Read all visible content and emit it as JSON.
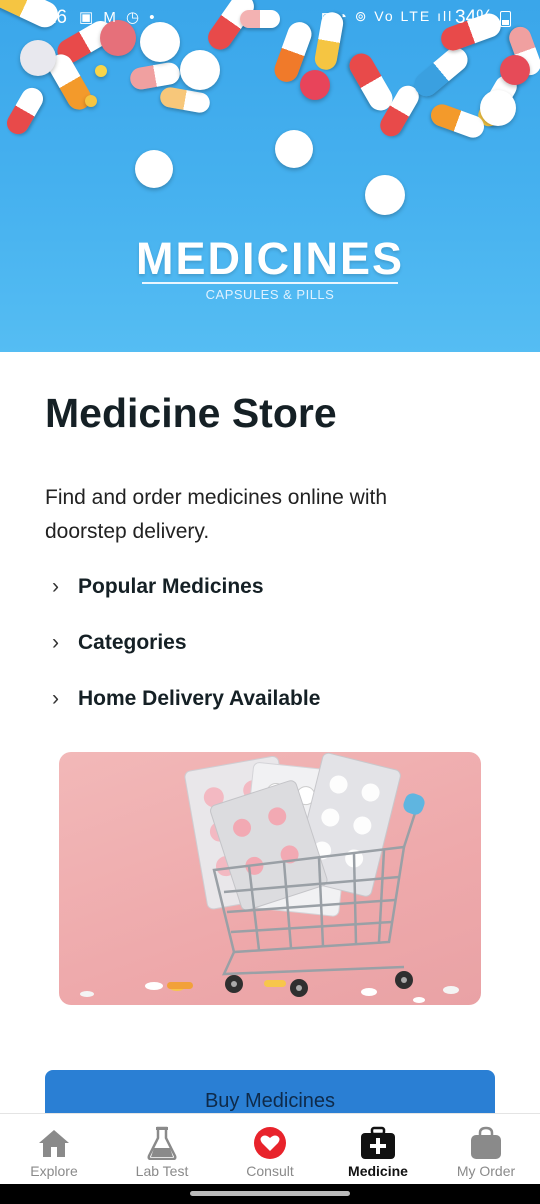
{
  "status_bar": {
    "time": "3:26",
    "left_icons": "▣ M ◷ •",
    "right_icons": "◙ ◔ ⊚ Vo LTE ıll",
    "battery": "34%"
  },
  "hero": {
    "title": "MEDICINES",
    "subtitle": "CAPSULES & PILLS"
  },
  "content": {
    "title": "Medicine Store",
    "description": "Find and order medicines online with doorstep delivery.",
    "features": [
      {
        "label": "Popular Medicines",
        "icon": "chevron-right-icon"
      },
      {
        "label": "Categories",
        "icon": "chevron-right-icon"
      },
      {
        "label": "Home Delivery Available",
        "icon": "chevron-right-icon"
      }
    ],
    "buy_button": "Buy Medicines"
  },
  "bottom_nav": {
    "items": [
      {
        "label": "Explore",
        "icon": "home-icon",
        "active": false
      },
      {
        "label": "Lab Test",
        "icon": "flask-icon",
        "active": false
      },
      {
        "label": "Consult",
        "icon": "heart-icon",
        "active": false
      },
      {
        "label": "Medicine",
        "icon": "medical-bag-icon",
        "active": true
      },
      {
        "label": "My Order",
        "icon": "shopping-bag-icon",
        "active": false
      }
    ]
  },
  "colors": {
    "hero_blue": "#46b1ef",
    "button_blue": "#2a7fd4",
    "consult_red": "#e8232b",
    "active_nav": "#111111",
    "inactive_nav": "#8a8a8a"
  }
}
